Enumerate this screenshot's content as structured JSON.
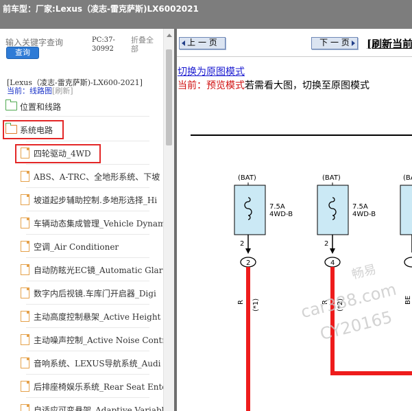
{
  "titlebar": {
    "label": "前车型：",
    "value": "厂家:Lexus（凌志-雷克萨斯)LX6002021"
  },
  "left": {
    "search_placeholder": "输入关键字查询",
    "search_button": "查询",
    "pc_code": "PC:37-30992",
    "collapse_all": "折叠全部",
    "model_line": "[Lexus（凌志-雷克萨斯)-LX600-2021]",
    "current_label": "当前：",
    "current_value": "线路图",
    "refresh": "[刷新]",
    "tree": [
      {
        "label": "位置和线路",
        "icon": "folder-icon",
        "highlight": false
      },
      {
        "label": "系统电路",
        "icon": "folder-open-icon",
        "highlight": true
      },
      {
        "label": "四轮驱动_4WD",
        "icon": "document-icon",
        "highlight": true
      },
      {
        "label": "ABS、A-TRC、全地形系统、下坡",
        "icon": "document-icon",
        "highlight": false
      },
      {
        "label": "坡道起步辅助控制.多地形选择_Hi",
        "icon": "document-icon",
        "highlight": false
      },
      {
        "label": "车辆动态集成管理_Vehicle Dynam",
        "icon": "document-icon",
        "highlight": false
      },
      {
        "label": "空调_Air Conditioner",
        "icon": "document-icon",
        "highlight": false
      },
      {
        "label": "自动防眩光EC镜_Automatic Glare",
        "icon": "document-icon",
        "highlight": false
      },
      {
        "label": "数字内后视镜.车库门开启器_Digi",
        "icon": "document-icon",
        "highlight": false
      },
      {
        "label": "主动高度控制悬架_Active Height",
        "icon": "document-icon",
        "highlight": false
      },
      {
        "label": "主动噪声控制_Active Noise Contr",
        "icon": "document-icon",
        "highlight": false
      },
      {
        "label": "音响系统、LEXUS导航系统_Audi",
        "icon": "document-icon",
        "highlight": false
      },
      {
        "label": "后排座椅娱乐系统_Rear Seat Ente",
        "icon": "document-icon",
        "highlight": false
      },
      {
        "label": "自适应可变悬架_Adaptive Variabl",
        "icon": "document-icon",
        "highlight": false
      }
    ]
  },
  "right": {
    "prev_button": "上 一 页",
    "next_button": "下 一 页",
    "refresh_link": "[刷新当前",
    "switch_link": "切换为原图模式",
    "status_label": "当前：",
    "status_mode": "预览模式",
    "status_tip": "若需看大图，切换至原图模式",
    "diagram": {
      "fuses": [
        {
          "source": "(BAT)",
          "rating": "7.5A",
          "name": "4WD-B",
          "pin": "2",
          "connector": "2",
          "wire": "R",
          "note": "(*1)"
        },
        {
          "source": "(BAT)",
          "rating": "7.5A",
          "name": "4WD-B",
          "pin": "2",
          "connector": "4",
          "wire": "R",
          "note": "(*2)"
        },
        {
          "source": "(BAT)",
          "wire": "BE"
        }
      ]
    },
    "watermark": [
      "畅易",
      "car388.com",
      "CY20165"
    ]
  },
  "colors": {
    "wire": "#ee1c1c",
    "fuse_box": "#cbe9f5",
    "highlight_border": "#e32626",
    "link": "#1a1ad0"
  }
}
